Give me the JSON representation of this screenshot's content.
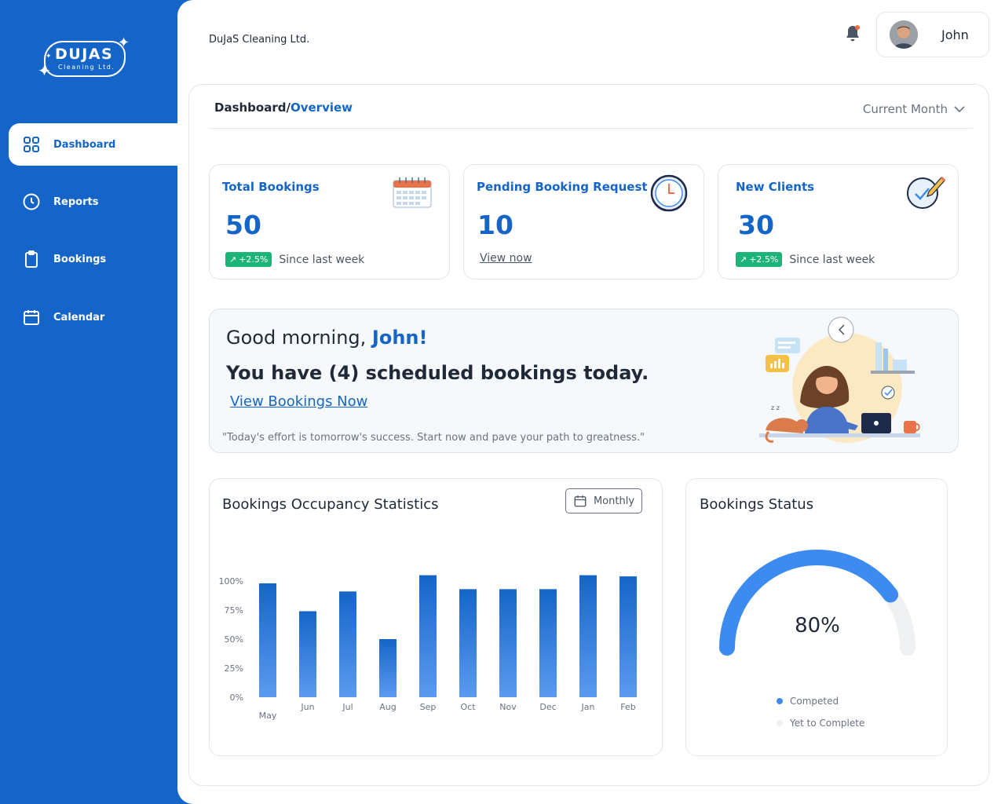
{
  "brand": {
    "logo_main": "DUJAS",
    "logo_sub": "Cleaning Ltd.",
    "company_name": "DuJaS Cleaning Ltd."
  },
  "sidebar": {
    "items": [
      {
        "label": "Dashboard",
        "icon": "grid-icon",
        "active": true
      },
      {
        "label": "Reports",
        "icon": "clock-icon",
        "active": false
      },
      {
        "label": "Bookings",
        "icon": "clipboard-icon",
        "active": false
      },
      {
        "label": "Calendar",
        "icon": "calendar-icon",
        "active": false
      }
    ]
  },
  "header": {
    "user_name": "John"
  },
  "breadcrumb": {
    "root": "Dashboard/",
    "current": "Overview"
  },
  "period_select": {
    "selected": "Current Month"
  },
  "stats": [
    {
      "title": "Total Bookings",
      "value": "50",
      "trend": "+2.5%",
      "note": "Since last week"
    },
    {
      "title": "Pending Booking Request",
      "value": "10",
      "link": "View now"
    },
    {
      "title": "New Clients",
      "value": "30",
      "trend": "+2.5%",
      "note": "Since last week"
    }
  ],
  "banner": {
    "greeting": "Good morning, ",
    "name": "John!",
    "scheduled": "You have (4) scheduled bookings today.",
    "link": "View Bookings Now",
    "quote": "\"Today's effort is tomorrow's success. Start now and pave your path to greatness.\""
  },
  "occupancy": {
    "title": "Bookings Occupancy Statistics",
    "filter": "Monthly"
  },
  "status": {
    "title": "Bookings Status",
    "value_label": "80%",
    "legend": [
      "Competed",
      "Yet to Complete"
    ]
  },
  "colors": {
    "primary": "#1565c8",
    "accent_green": "#1db47a",
    "gauge_track": "#eef0f2",
    "gauge_fill": "#3d8bf0"
  },
  "chart_data": [
    {
      "type": "bar",
      "title": "Bookings Occupancy Statistics",
      "categories": [
        "May",
        "Jun",
        "Jul",
        "Aug",
        "Sep",
        "Oct",
        "Nov",
        "Dec",
        "Jan",
        "Feb"
      ],
      "values": [
        98,
        74,
        91,
        50,
        105,
        93,
        93,
        93,
        105,
        104
      ],
      "yticks": [
        "100%",
        "75%",
        "50%",
        "25%",
        "0%"
      ],
      "ylim": [
        0,
        100
      ]
    },
    {
      "type": "pie",
      "title": "Bookings Status",
      "labels": [
        "Competed",
        "Yet to Complete"
      ],
      "values": [
        80,
        20
      ]
    }
  ]
}
